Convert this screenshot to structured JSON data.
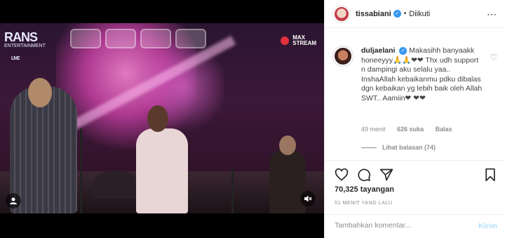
{
  "video": {
    "logo_main": "RANS",
    "logo_sub": "ENTERTAINMENT",
    "logo_live": "LIVE",
    "stream_line1": "MAX",
    "stream_line2": "STREAM"
  },
  "post": {
    "username": "tissabiani",
    "separator": "•",
    "follow_status": "Diikuti"
  },
  "comment": {
    "username": "duljaelani",
    "text": "Makasihh banyaakk honeeyyy🙏🙏❤❤ Thx udh support n dampingi aku selalu yaa.. InshaAllah kebaikanmu pdku dibalas dgn kebaikan yg lebih baik oleh Allah SWT.. Aamiin❤ ❤❤",
    "time": "49 menit",
    "likes": "626 suka",
    "reply": "Balas",
    "view_replies": "Lihat balasan (74)"
  },
  "stats": {
    "views": "70,325 tayangan",
    "posted_ago": "51 MENIT YANG LALU"
  },
  "add_comment": {
    "placeholder": "Tambahkan komentar...",
    "post_label": "Kirim"
  },
  "colors": {
    "verified": "#3897f0",
    "heart": "#e0202e",
    "muted": "#8e8e8e",
    "post_disabled": "#b2dffc"
  }
}
